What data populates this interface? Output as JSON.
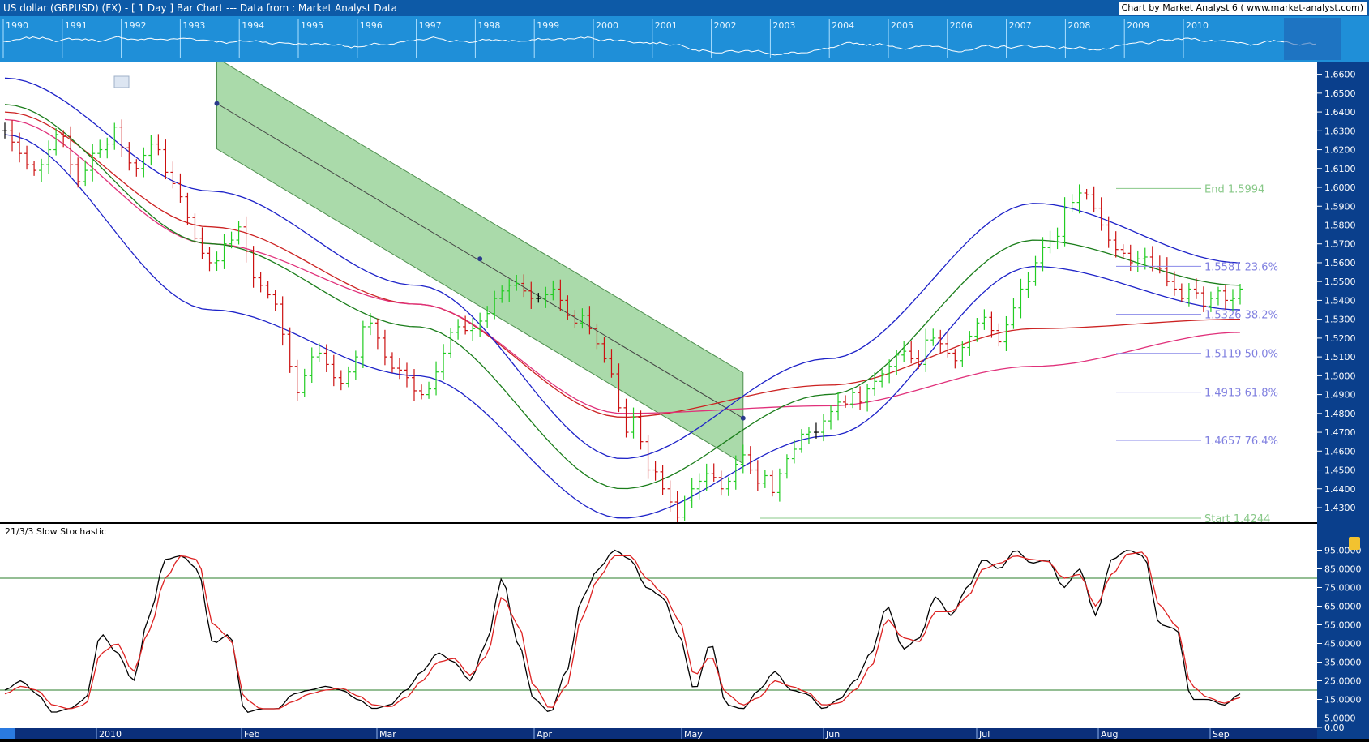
{
  "window": {
    "title": "US dollar (GBPUSD) (FX) -  [ 1 Day ] Bar Chart --- Data from : Market Analyst Data",
    "credit": "Chart by Market Analyst 6 ( www.market-analyst.com)"
  },
  "overview": {
    "years": [
      "1990",
      "1991",
      "1992",
      "1993",
      "1994",
      "1995",
      "1996",
      "1997",
      "1998",
      "1999",
      "2000",
      "2001",
      "2002",
      "2003",
      "2004",
      "2005",
      "2006",
      "2007",
      "2008",
      "2009",
      "2010"
    ]
  },
  "colors": {
    "background": "#ffffff",
    "up_bar": "#22cc22",
    "down_bar": "#cc1111",
    "neutral_bar": "#000000",
    "ma_red": "#cc2222",
    "ma_pink": "#e0307a",
    "channel_blue": "#1d22c8",
    "channel_green": "#1a7d1a",
    "pitchfork_fill": "#7cc67c",
    "fib_line": "#8a8ae8",
    "fib_text": "#8080e0",
    "start_end_text": "#88c888",
    "stoch_k": "#000000",
    "stoch_d": "#dd2222",
    "axis_blue": "#0a3f8c"
  },
  "chart_data": [
    {
      "type": "bar",
      "subtype": "ohlc",
      "instrument": "US dollar (GBPUSD) (FX)",
      "interval": "1 Day",
      "ylim": [
        1.4244,
        1.665
      ],
      "y_ticks": [
        "1.6600",
        "1.6500",
        "1.6400",
        "1.6300",
        "1.6200",
        "1.6100",
        "1.6000",
        "1.5900",
        "1.5800",
        "1.5700",
        "1.5600",
        "1.5500",
        "1.5400",
        "1.5300",
        "1.5200",
        "1.5100",
        "1.5000",
        "1.4900",
        "1.4800",
        "1.4700",
        "1.4600",
        "1.4500",
        "1.4400",
        "1.4300"
      ],
      "x_ticks": [
        "2010",
        "Feb",
        "Mar",
        "Apr",
        "May",
        "Jun",
        "Jul",
        "Aug",
        "Sep"
      ],
      "close_series": [
        1.63,
        1.624,
        1.618,
        1.612,
        1.609,
        1.612,
        1.62,
        1.628,
        1.627,
        1.612,
        1.603,
        1.609,
        1.618,
        1.62,
        1.623,
        1.632,
        1.621,
        1.613,
        1.61,
        1.617,
        1.623,
        1.62,
        1.608,
        1.602,
        1.595,
        1.584,
        1.573,
        1.565,
        1.56,
        1.561,
        1.57,
        1.572,
        1.579,
        1.566,
        1.552,
        1.548,
        1.543,
        1.538,
        1.522,
        1.505,
        1.491,
        1.5,
        1.51,
        1.512,
        1.506,
        1.499,
        1.496,
        1.502,
        1.51,
        1.526,
        1.528,
        1.52,
        1.51,
        1.504,
        1.503,
        1.499,
        1.492,
        1.49,
        1.493,
        1.502,
        1.512,
        1.523,
        1.526,
        1.524,
        1.525,
        1.529,
        1.533,
        1.541,
        1.545,
        1.548,
        1.549,
        1.545,
        1.541,
        1.541,
        1.543,
        1.546,
        1.54,
        1.532,
        1.528,
        1.532,
        1.525,
        1.517,
        1.509,
        1.501,
        1.483,
        1.47,
        1.478,
        1.465,
        1.45,
        1.449,
        1.44,
        1.433,
        1.425,
        1.434,
        1.44,
        1.444,
        1.448,
        1.446,
        1.44,
        1.444,
        1.453,
        1.458,
        1.45,
        1.443,
        1.447,
        1.438,
        1.448,
        1.456,
        1.461,
        1.469,
        1.47,
        1.47,
        1.476,
        1.481,
        1.486,
        1.485,
        1.491,
        1.486,
        1.493,
        1.497,
        1.501,
        1.505,
        1.511,
        1.513,
        1.509,
        1.506,
        1.519,
        1.52,
        1.517,
        1.512,
        1.508,
        1.515,
        1.521,
        1.528,
        1.531,
        1.524,
        1.518,
        1.527,
        1.536,
        1.546,
        1.55,
        1.56,
        1.568,
        1.571,
        1.574,
        1.589,
        1.592,
        1.597,
        1.596,
        1.589,
        1.58,
        1.572,
        1.567,
        1.565,
        1.56,
        1.562,
        1.563,
        1.558,
        1.557,
        1.55,
        1.546,
        1.541,
        1.546,
        1.544,
        1.537,
        1.541,
        1.545,
        1.54,
        1.541,
        1.546
      ],
      "pitchfork_anchors": [
        {
          "date_index": 29,
          "price": 1.6445
        },
        {
          "date_index": 65,
          "price": 1.562
        },
        {
          "date_index": 101,
          "price": 1.4775
        }
      ],
      "moving_averages": [
        {
          "style": "red",
          "values": [
            1.64,
            1.579,
            1.538,
            1.478,
            1.495,
            1.525,
            1.53
          ]
        },
        {
          "style": "pink",
          "values": [
            1.636,
            1.57,
            1.538,
            1.48,
            1.484,
            1.505,
            1.523
          ]
        }
      ],
      "bands": [
        {
          "style": "blue-upper",
          "values": [
            1.658,
            1.598,
            1.548,
            1.456,
            1.509,
            1.5915,
            1.56
          ]
        },
        {
          "style": "green-mid",
          "values": [
            1.644,
            1.57,
            1.526,
            1.44,
            1.49,
            1.572,
            1.548
          ]
        },
        {
          "style": "blue-lower",
          "values": [
            1.628,
            1.535,
            1.5,
            1.4244,
            1.468,
            1.558,
            1.535
          ]
        }
      ],
      "fibonacci": {
        "levels": [
          {
            "label": "End 1.5994",
            "price": 1.5994
          },
          {
            "label": "1.5581 23.6%",
            "price": 1.5581
          },
          {
            "label": "1.5326 38.2%",
            "price": 1.5326
          },
          {
            "label": "1.5119 50.0%",
            "price": 1.5119
          },
          {
            "label": "1.4913 61.8%",
            "price": 1.4913
          },
          {
            "label": "1.4657 76.4%",
            "price": 1.4657
          },
          {
            "label": "Start 1.4244",
            "price": 1.4244
          }
        ]
      }
    },
    {
      "type": "line",
      "title": "21/3/3 Slow Stochastic",
      "ylim": [
        0,
        100
      ],
      "y_ticks": [
        "95.0000",
        "85.0000",
        "75.0000",
        "65.0000",
        "55.0000",
        "45.0000",
        "35.0000",
        "25.0000",
        "15.0000",
        "5.0000",
        "0.00"
      ],
      "reference_lines": [
        80,
        20
      ],
      "series": [
        {
          "color": "black",
          "values": [
            20,
            25,
            18,
            8,
            10,
            15,
            50,
            40,
            25,
            60,
            90,
            92,
            85,
            45,
            50,
            8,
            10,
            10,
            18,
            20,
            22,
            20,
            15,
            10,
            12,
            20,
            30,
            40,
            35,
            25,
            45,
            80,
            45,
            15,
            8,
            30,
            70,
            85,
            95,
            90,
            75,
            70,
            50,
            20,
            45,
            12,
            10,
            20,
            30,
            20,
            18,
            10,
            15,
            25,
            40,
            65,
            42,
            48,
            70,
            60,
            75,
            90,
            85,
            95,
            88,
            90,
            75,
            85,
            60,
            90,
            95,
            92,
            55,
            53,
            15,
            15,
            12,
            18
          ]
        },
        {
          "color": "red",
          "values": [
            18,
            22,
            20,
            12,
            10,
            12,
            40,
            45,
            30,
            52,
            80,
            92,
            90,
            55,
            48,
            15,
            10,
            10,
            14,
            18,
            20,
            21,
            17,
            12,
            11,
            16,
            25,
            35,
            37,
            28,
            38,
            70,
            55,
            22,
            10,
            22,
            60,
            80,
            92,
            92,
            80,
            72,
            58,
            28,
            38,
            18,
            12,
            16,
            25,
            22,
            19,
            12,
            13,
            20,
            33,
            58,
            48,
            46,
            62,
            62,
            70,
            85,
            88,
            92,
            90,
            89,
            80,
            82,
            65,
            82,
            93,
            94,
            65,
            55,
            22,
            16,
            13,
            16
          ]
        }
      ]
    }
  ]
}
